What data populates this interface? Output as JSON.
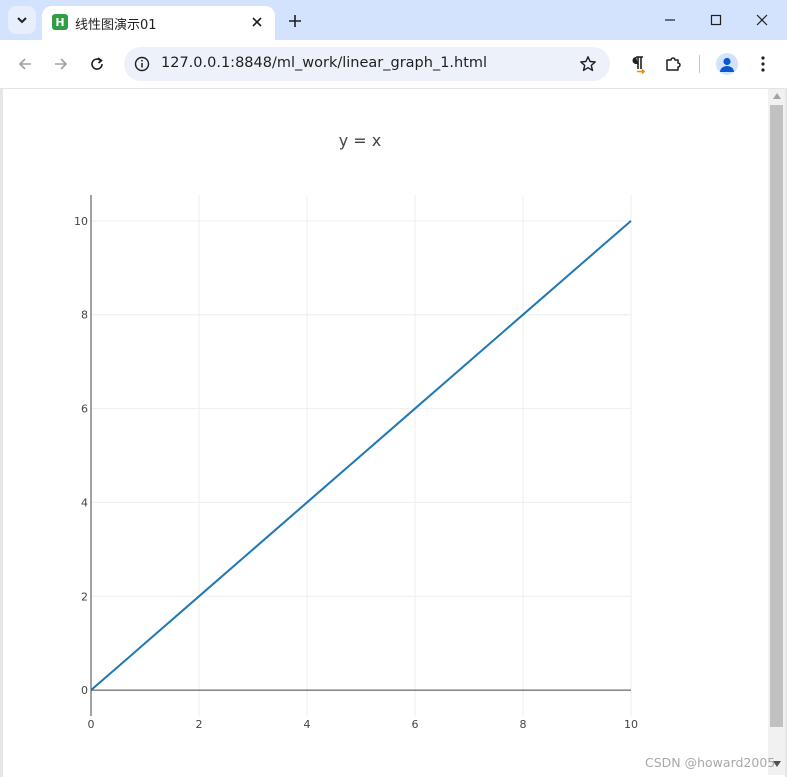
{
  "browser": {
    "tab": {
      "title": "线性图演示01",
      "favicon_letter": "H"
    },
    "address_bar": {
      "url": "127.0.0.1:8848/ml_work/linear_graph_1.html"
    }
  },
  "icons": [
    "tab-search-icon",
    "close-icon",
    "plus-icon",
    "minimize-icon",
    "maximize-icon",
    "window-close-icon",
    "back-icon",
    "forward-icon",
    "reload-icon",
    "site-info-icon",
    "star-icon",
    "pilcrow-icon",
    "extensions-icon",
    "profile-icon",
    "more-icon"
  ],
  "colors": {
    "line": "#1f77b4",
    "tabstrip": "#d3e3fd",
    "omnibox": "#edf2fa",
    "favicon": "#2f9e44",
    "pilcrow_accent": "#f08c00"
  },
  "chart_data": {
    "type": "line",
    "title": "y = x",
    "series": [
      {
        "x": [
          0,
          1,
          2,
          3,
          4,
          5,
          6,
          7,
          8,
          9,
          10
        ],
        "y": [
          0,
          1,
          2,
          3,
          4,
          5,
          6,
          7,
          8,
          9,
          10
        ]
      }
    ],
    "xlim": [
      0,
      10
    ],
    "ylim": [
      -0.55,
      10.55
    ],
    "xticks": [
      0,
      2,
      4,
      6,
      8,
      10
    ],
    "yticks": [
      0,
      2,
      4,
      6,
      8,
      10
    ],
    "grid": true,
    "legend": false,
    "xlabel": "",
    "ylabel": ""
  },
  "watermark": "CSDN @howard2005"
}
